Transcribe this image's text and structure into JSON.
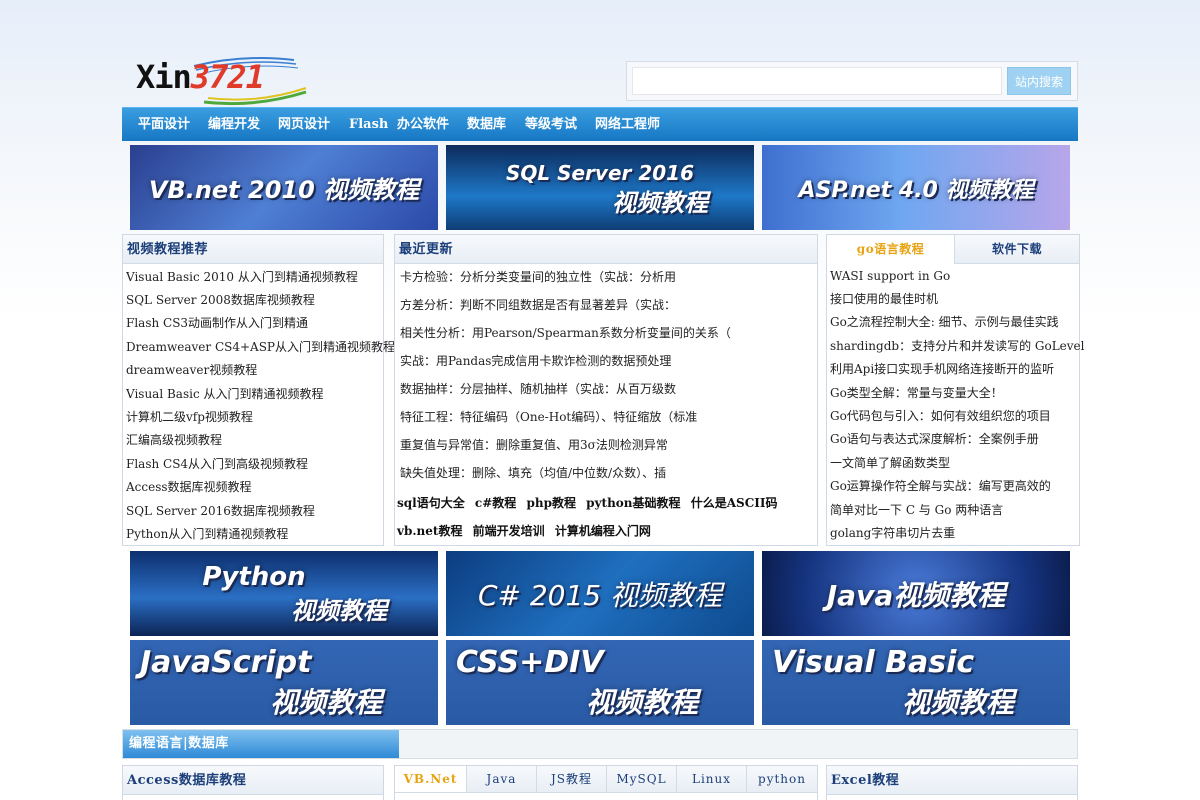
{
  "header": {
    "logo_text": "Xin3721",
    "search": {
      "placeholder": "",
      "value": "",
      "button_label": "站内搜索"
    }
  },
  "nav": {
    "items": [
      "平面设计",
      "编程开发",
      "网页设计",
      "Flash",
      "办公软件",
      "数据库",
      "等级考试",
      "网络工程师"
    ]
  },
  "banners_top": [
    {
      "text": "VB.net 2010 视频教程"
    },
    {
      "line1": "SQL Server 2016",
      "line2": "视频教程"
    },
    {
      "text": "ASP.net 4.0 视频教程"
    }
  ],
  "video_panel": {
    "title": "视频教程推荐",
    "items": [
      "Visual Basic 2010 从入门到精通视频教程",
      "SQL Server 2008数据库视频教程",
      "Flash CS3动画制作从入门到精通",
      "Dreamweaver CS4+ASP从入门到精通视频教程",
      "dreamweaver视频教程",
      "Visual Basic 从入门到精通视频教程",
      "计算机二级vfp视频教程",
      "汇编高级视频教程",
      "Flash CS4从入门到高级视频教程",
      "Access数据库视频教程",
      "SQL Server 2016数据库视频教程",
      "Python从入门到精通视频教程"
    ]
  },
  "recent_panel": {
    "title": "最近更新",
    "items": [
      "卡方检验：分析分类变量间的独立性（实战：分析用",
      "方差分析：判断不同组数据是否有显著差异（实战：",
      "相关性分析：用Pearson/Spearman系数分析变量间的关系（",
      "实战：用Pandas完成信用卡欺诈检测的数据预处理",
      "数据抽样：分层抽样、随机抽样（实战：从百万级数",
      "特征工程：特征编码（One-Hot编码）、特征缩放（标准",
      "重复值与异常值：删除重复值、用3σ法则检测异常",
      "缺失值处理：删除、填充（均值/中位数/众数）、插"
    ],
    "keywords": [
      "sql语句大全",
      "c#教程",
      "php教程",
      "python基础教程",
      "什么是ASCII码",
      "vb.net教程",
      "前端开发培训",
      "计算机编程入门网"
    ]
  },
  "go_panel": {
    "tabs": [
      "go语言教程",
      "软件下载"
    ],
    "items": [
      "WASI support in Go",
      "接口使用的最佳时机",
      "Go之流程控制大全: 细节、示例与最佳实践",
      "shardingdb：支持分片和并发读写的 GoLevel",
      "利用Api接口实现手机网络连接断开的监听",
      "Go类型全解：常量与变量大全！",
      "Go代码包与引入：如何有效组织您的项目",
      "Go语句与表达式深度解析：全案例手册",
      "一文简单了解函数类型",
      "Go运算操作符全解与实战：编写更高效的",
      "简单对比一下 C 与 Go 两种语言",
      "golang字符串切片去重"
    ]
  },
  "banners_middle": [
    {
      "line1": "Python",
      "line2": "视频教程"
    },
    {
      "text": "C# 2015 视频教程"
    },
    {
      "text": "Java视频教程"
    },
    {
      "line1": "JavaScript",
      "line2": "视频教程"
    },
    {
      "line1": "CSS+DIV",
      "line2": "视频教程"
    },
    {
      "line1": "Visual Basic",
      "line2": "视频教程"
    }
  ],
  "section_bar": {
    "title": "编程语言|数据库"
  },
  "bottom_panels": {
    "access_title": "Access数据库教程",
    "tabs": [
      "VB.Net",
      "Java",
      "JS教程",
      "MySQL",
      "Linux",
      "python"
    ],
    "excel_title": "Excel教程"
  },
  "colors": {
    "nav_blue": "#1677c4",
    "active_tab": "#e8a312",
    "panel_title": "#1c3f7a",
    "search_button": "#9fd2f2"
  }
}
